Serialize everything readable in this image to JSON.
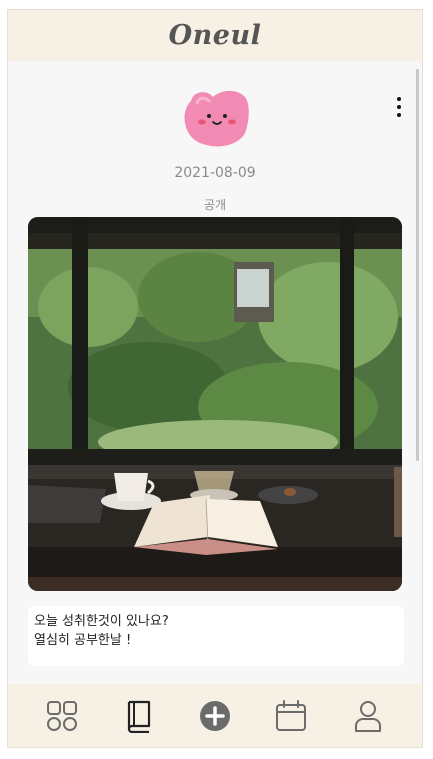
{
  "app": {
    "title": "Oneul"
  },
  "post": {
    "date": "2021-08-09",
    "visibility": "공개",
    "mood_icon": "pink-heart-face-icon",
    "photo_description_icon": "cafe-window-photo",
    "text_lines": [
      "오늘 성취한것이 있나요?",
      "열심히 공부한날 !"
    ]
  },
  "tabbar": {
    "items": [
      {
        "icon": "grid-icon"
      },
      {
        "icon": "book-icon"
      },
      {
        "icon": "plus-circle-icon"
      },
      {
        "icon": "calendar-icon"
      },
      {
        "icon": "user-icon"
      }
    ]
  },
  "colors": {
    "header_bg": "#f7f0e4",
    "mood_pink": "#f28bb3",
    "icon_gray": "#6b6b6b"
  }
}
